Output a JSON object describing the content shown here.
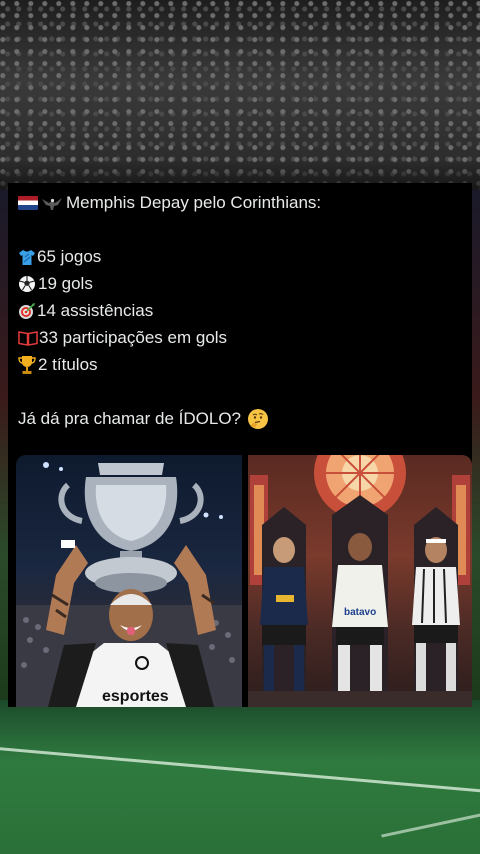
{
  "tweet": {
    "header": "Memphis Depay pelo Corinthians:",
    "stats": [
      {
        "icon": "shirt-icon",
        "text": "65 jogos"
      },
      {
        "icon": "soccer-ball-icon",
        "text": "19 gols"
      },
      {
        "icon": "target-icon",
        "text": "14 assistências"
      },
      {
        "icon": "book-icon",
        "text": "33 participações em gols"
      },
      {
        "icon": "trophy-icon",
        "text": "2 títulos"
      }
    ],
    "question": "Já dá pra chamar de ÍDOLO?"
  },
  "images": {
    "left": {
      "shirt_text": "esportes"
    },
    "right": {
      "shirt_text": "batavo"
    }
  },
  "colors": {
    "card_bg": "#000000",
    "text": "#e7e9ea",
    "pitch": "#2f7a3f"
  }
}
